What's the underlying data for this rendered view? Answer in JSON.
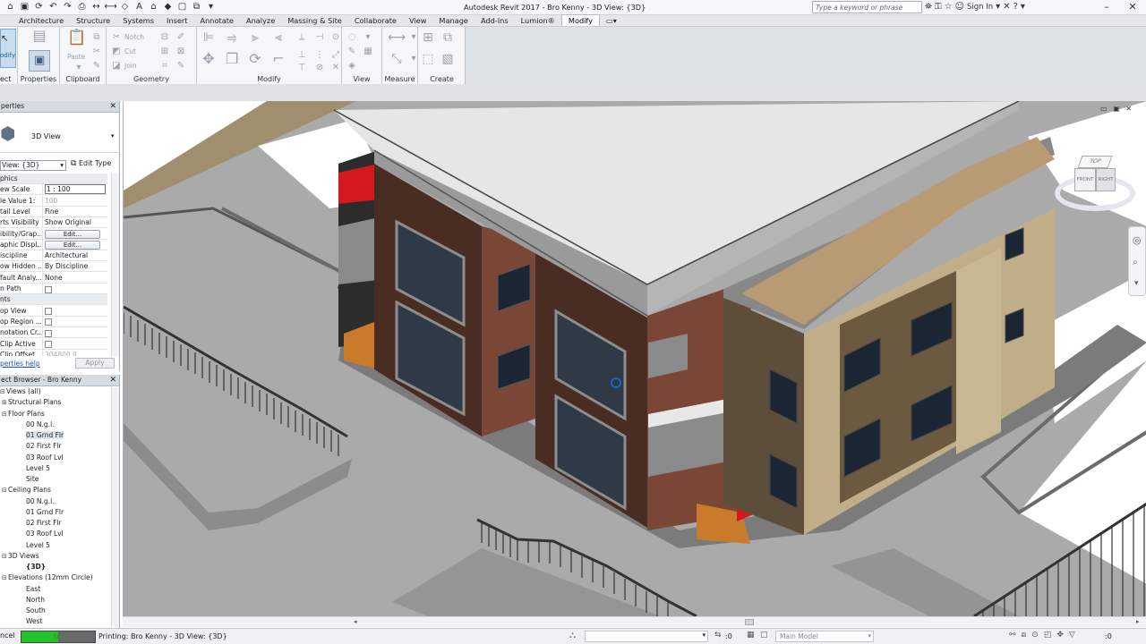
{
  "app": {
    "title": "Autodesk Revit 2017 -    Bro Kenny - 3D View: {3D}",
    "search_placeholder": "Type a keyword or phrase",
    "sign_in": "Sign In"
  },
  "tabs": [
    "Architecture",
    "Structure",
    "Systems",
    "Insert",
    "Annotate",
    "Analyze",
    "Massing & Site",
    "Collaborate",
    "View",
    "Manage",
    "Add-Ins",
    "Lumion®",
    "Modify"
  ],
  "active_tab": "Modify",
  "ribbon": {
    "select_label": "ect",
    "modify_label": "odify",
    "panels": {
      "properties": "Properties",
      "clipboard": "Clipboard",
      "geometry": "Geometry",
      "modify": "Modify",
      "view": "View",
      "measure": "Measure",
      "create": "Create"
    },
    "paste": "Paste",
    "notch": "Notch",
    "cut": "Cut",
    "join": "Join"
  },
  "properties_panel": {
    "header": "perties",
    "type_name": "3D View",
    "selector": "View: {3D}",
    "edit_type": "Edit Type",
    "rows": [
      {
        "k": "phics",
        "v": "",
        "section": true
      },
      {
        "k": "ew Scale",
        "v": "1 : 100"
      },
      {
        "k": "le Value   1:",
        "v": "100",
        "dim": true
      },
      {
        "k": "tail Level",
        "v": "Fine"
      },
      {
        "k": "rts Visibility",
        "v": "Show Original"
      },
      {
        "k": "ibility/Grap...",
        "v": "Edit...",
        "btn": true
      },
      {
        "k": "aphic Displ...",
        "v": "Edit...",
        "btn": true
      },
      {
        "k": "iscipline",
        "v": "Architectural"
      },
      {
        "k": "ow Hidden ...",
        "v": "By Discipline"
      },
      {
        "k": "fault Analy...",
        "v": "None"
      },
      {
        "k": "n Path",
        "v": "",
        "cb": true
      },
      {
        "k": "nts",
        "v": "",
        "section": true
      },
      {
        "k": "op View",
        "v": "",
        "cb": true
      },
      {
        "k": "op Region ...",
        "v": "",
        "cb": true
      },
      {
        "k": "notation Cr...",
        "v": "",
        "cb": true
      },
      {
        "k": " Clip Active",
        "v": "",
        "cb": true
      },
      {
        "k": " Clip Offset",
        "v": "304800.0",
        "dim": true
      }
    ],
    "help": "perties help",
    "apply": "Apply"
  },
  "project_browser": {
    "header": "ect Browser - Bro Kenny",
    "nodes": [
      {
        "t": "Views (all)",
        "l": 0,
        "e": "-"
      },
      {
        "t": "Structural Plans",
        "l": 1,
        "e": "+"
      },
      {
        "t": "Floor Plans",
        "l": 1,
        "e": "-"
      },
      {
        "t": "00 N.g.l.",
        "l": 2
      },
      {
        "t": "01 Grnd Flr",
        "l": 2,
        "sel": true
      },
      {
        "t": "02 First Flr",
        "l": 2
      },
      {
        "t": "03 Roof Lvl",
        "l": 2
      },
      {
        "t": "Level 5",
        "l": 2
      },
      {
        "t": "Site",
        "l": 2
      },
      {
        "t": "Ceiling Plans",
        "l": 1,
        "e": "-"
      },
      {
        "t": "00 N.g.l.",
        "l": 2
      },
      {
        "t": "01 Grnd Flr",
        "l": 2
      },
      {
        "t": "02 First Flr",
        "l": 2
      },
      {
        "t": "03 Roof Lvl",
        "l": 2
      },
      {
        "t": "Level 5",
        "l": 2
      },
      {
        "t": "3D Views",
        "l": 1,
        "e": "-"
      },
      {
        "t": "{3D}",
        "l": 2,
        "bold": true
      },
      {
        "t": "Elevations (12mm Circle)",
        "l": 1,
        "e": "-"
      },
      {
        "t": "East",
        "l": 2
      },
      {
        "t": "North",
        "l": 2
      },
      {
        "t": "South",
        "l": 2
      },
      {
        "t": "West",
        "l": 2
      }
    ]
  },
  "viewcube": {
    "top": "TOP",
    "front": "FRONT",
    "right": "RIGHT"
  },
  "status": {
    "cancel": "ncel",
    "progress_pct": 50,
    "progress_text": "50%",
    "message": "Printing: Bro Kenny - 3D View: {3D}",
    "zero": ":0",
    "model": "Main Model"
  },
  "colors": {
    "brick": "#7a4636",
    "dark_panel": "#4a2d22",
    "red": "#d4181f",
    "beige": "#bfae88",
    "roof": "#e6e6e6",
    "site": "#a9a9a9"
  }
}
